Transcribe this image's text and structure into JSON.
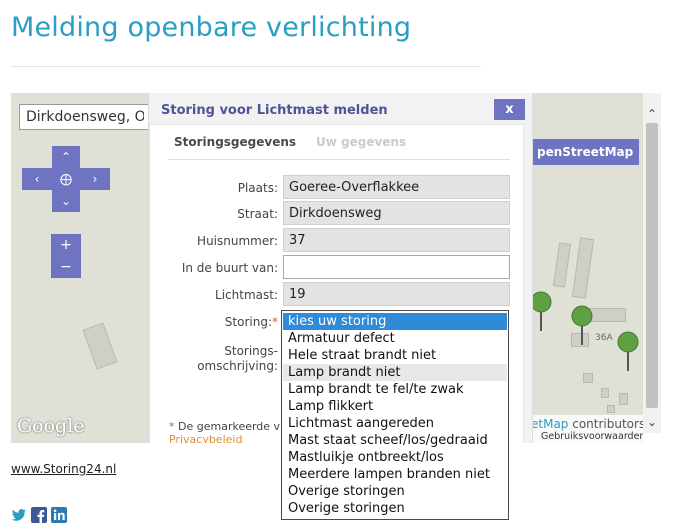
{
  "page": {
    "title": "Melding openbare verlichting"
  },
  "map": {
    "search_value": "Dirkdoensweg, Ou",
    "controls": {
      "pan_up": "up-arrow-icon",
      "pan_down": "down-arrow-icon",
      "pan_left": "left-arrow-icon",
      "pan_right": "right-arrow-icon",
      "center": "crosshair-icon",
      "zoom_in_label": "+",
      "zoom_out_label": "−"
    },
    "osm_button_label": "penStreetMap",
    "google_logo": "Google",
    "attribution_prefix": "etMap",
    "attribution_suffix": " contributors",
    "terms": "Gebruiksvoorwaarden",
    "house_number_label": "36A",
    "accent_color": "#6e73c2",
    "pin_color": "#5fa142"
  },
  "dialog": {
    "title": "Storing voor Lichtmast melden",
    "close_label": "x",
    "tabs": [
      {
        "label": "Storingsgegevens",
        "active": true
      },
      {
        "label": "Uw gegevens",
        "active": false
      }
    ],
    "fields": [
      {
        "label": "Plaats:",
        "value": "Goeree-Overflakkee"
      },
      {
        "label": "Straat:",
        "value": "Dirkdoensweg"
      },
      {
        "label": "Huisnummer:",
        "value": "37"
      },
      {
        "label": "In de buurt van:",
        "value": ""
      },
      {
        "label": "Lichtmast:",
        "value": "19"
      }
    ],
    "storing_label": "Storing:",
    "required_mark": "*",
    "omschrijving_label_1": "Storings-",
    "omschrijving_label_2": "omschrijving:",
    "required_note": "De gemarkeerde v",
    "privacy_link": "Privacybeleid"
  },
  "storing_select": {
    "options": [
      "kies uw storing",
      "Armatuur defect",
      "Hele straat brandt niet",
      "Lamp brandt niet",
      "Lamp brandt te fel/te zwak",
      "Lamp flikkert",
      "Lichtmast aangereden",
      "Mast staat scheef/los/gedraaid",
      "Mastluikje ontbreekt/los",
      "Meerdere lampen branden niet",
      "Overige storingen",
      "Overige storingen"
    ]
  },
  "footer": {
    "site_link": "www.Storing24.nl",
    "social": [
      "twitter-icon",
      "facebook-icon",
      "linkedin-icon"
    ]
  }
}
